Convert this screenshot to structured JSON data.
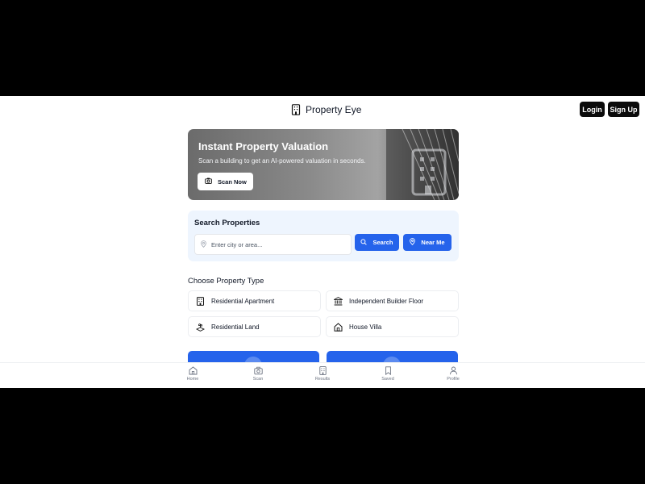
{
  "header": {
    "brand": "Property Eye",
    "login_label": "Login",
    "signup_label": "Sign Up"
  },
  "hero": {
    "title": "Instant Property Valuation",
    "subtitle": "Scan a building to get an AI-powered valuation in seconds.",
    "scan_label": "Scan Now"
  },
  "search": {
    "title": "Search Properties",
    "placeholder": "Enter city or area...",
    "search_label": "Search",
    "nearme_label": "Near Me"
  },
  "property_types": {
    "title": "Choose Property Type",
    "items": [
      {
        "label": "Residential Apartment",
        "icon": "building-icon"
      },
      {
        "label": "Independent Builder Floor",
        "icon": "landmark-icon"
      },
      {
        "label": "Residential Land",
        "icon": "land-icon"
      },
      {
        "label": "House Villa",
        "icon": "house-icon"
      }
    ]
  },
  "nav": {
    "items": [
      {
        "label": "Home",
        "icon": "home-icon"
      },
      {
        "label": "Scan",
        "icon": "camera-icon"
      },
      {
        "label": "Results",
        "icon": "building-icon"
      },
      {
        "label": "Saved",
        "icon": "bookmark-icon"
      },
      {
        "label": "Profile",
        "icon": "user-icon"
      }
    ]
  },
  "colors": {
    "primary": "#2563eb",
    "dark_button": "#0b0b0b",
    "search_bg": "#eef5fe"
  }
}
